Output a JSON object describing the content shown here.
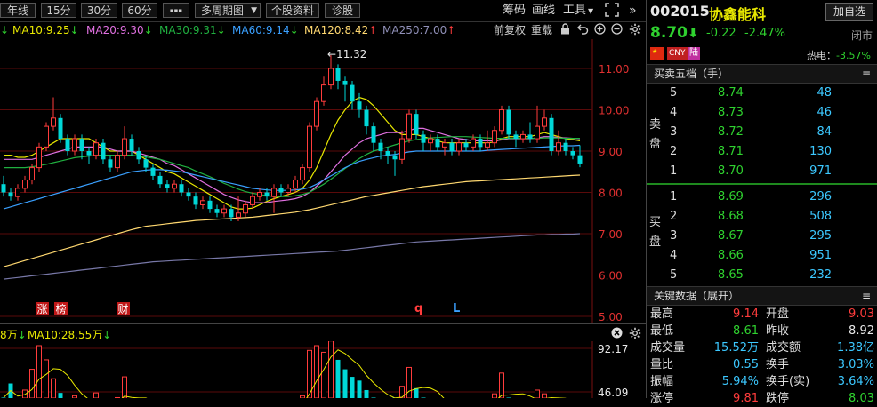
{
  "toolbar": {
    "periods": [
      "年线",
      "15分",
      "30分",
      "60分"
    ],
    "more": "▪▪▪",
    "multi_period": "多周期图",
    "stock_info": "个股资料",
    "diagnose": "诊股",
    "chip": "筹码",
    "draw": "画线",
    "tools": "工具"
  },
  "ma_bar": {
    "ma10": "MA10:9.25",
    "ma20": "MA20:9.30",
    "ma30": "MA30:9.31",
    "ma60": "MA60:9.14",
    "ma120": "MA120:8.42",
    "ma250": "MA250:7.00",
    "prev_adjust": "前复权",
    "redraw": "重载"
  },
  "colors": {
    "ma10": "#e8e800",
    "ma20": "#e070e0",
    "ma30": "#20b040",
    "ma60": "#3aa0ff",
    "ma120": "#ffd870",
    "ma250": "#7878a8",
    "up": "#ff3c3c",
    "down": "#00d8d8"
  },
  "chart_data": {
    "type": "candlestick",
    "y_ticks": [
      "11.00",
      "10.00",
      "9.00",
      "8.00",
      "7.00",
      "6.00",
      "5.00"
    ],
    "ylim": [
      5.0,
      11.5
    ],
    "high_marker": "←11.32",
    "tags": [
      "涨",
      "榜",
      "财"
    ],
    "letter_marks": [
      "q",
      "L"
    ],
    "candles": [
      [
        8.2,
        8.0,
        8.4,
        7.9
      ],
      [
        8.0,
        7.9,
        8.1,
        7.8
      ],
      [
        7.9,
        8.1,
        8.2,
        7.8
      ],
      [
        8.1,
        8.3,
        8.4,
        8.0
      ],
      [
        8.3,
        8.6,
        8.7,
        8.2
      ],
      [
        8.6,
        9.1,
        9.2,
        8.5
      ],
      [
        9.1,
        9.6,
        9.7,
        9.0
      ],
      [
        9.6,
        9.8,
        10.3,
        9.5
      ],
      [
        9.8,
        9.3,
        9.9,
        9.2
      ],
      [
        9.3,
        9.0,
        9.4,
        8.9
      ],
      [
        9.0,
        9.3,
        9.4,
        8.9
      ],
      [
        9.3,
        9.0,
        9.4,
        8.8
      ],
      [
        9.0,
        8.9,
        9.1,
        8.7
      ],
      [
        8.9,
        9.2,
        9.3,
        8.8
      ],
      [
        9.2,
        8.8,
        9.3,
        8.7
      ],
      [
        8.8,
        8.6,
        8.9,
        8.5
      ],
      [
        8.6,
        8.9,
        9.0,
        8.5
      ],
      [
        8.9,
        9.3,
        9.6,
        8.8
      ],
      [
        9.3,
        9.0,
        9.4,
        8.9
      ],
      [
        9.0,
        8.8,
        9.1,
        8.7
      ],
      [
        8.8,
        8.6,
        8.9,
        8.5
      ],
      [
        8.6,
        8.4,
        8.7,
        8.3
      ],
      [
        8.4,
        8.2,
        8.5,
        8.1
      ],
      [
        8.2,
        8.1,
        8.3,
        8.0
      ],
      [
        8.1,
        8.2,
        8.3,
        8.0
      ],
      [
        8.2,
        8.0,
        8.3,
        7.9
      ],
      [
        8.0,
        7.9,
        8.1,
        7.8
      ],
      [
        7.9,
        7.7,
        8.0,
        7.6
      ],
      [
        7.7,
        7.8,
        7.9,
        7.6
      ],
      [
        7.8,
        7.6,
        7.9,
        7.5
      ],
      [
        7.6,
        7.5,
        7.7,
        7.4
      ],
      [
        7.5,
        7.6,
        7.7,
        7.4
      ],
      [
        7.6,
        7.4,
        7.7,
        7.3
      ],
      [
        7.4,
        7.5,
        7.9,
        7.3
      ],
      [
        7.5,
        7.7,
        7.8,
        7.4
      ],
      [
        7.7,
        7.9,
        8.0,
        7.6
      ],
      [
        7.9,
        8.0,
        8.1,
        7.8
      ],
      [
        8.0,
        7.9,
        8.1,
        7.8
      ],
      [
        7.9,
        8.1,
        8.2,
        7.5
      ],
      [
        8.1,
        8.0,
        8.2,
        7.9
      ],
      [
        8.0,
        8.1,
        8.2,
        7.9
      ],
      [
        8.1,
        8.3,
        8.4,
        8.0
      ],
      [
        8.3,
        8.6,
        8.7,
        8.2
      ],
      [
        8.6,
        9.6,
        9.7,
        8.5
      ],
      [
        9.6,
        10.2,
        10.3,
        9.5
      ],
      [
        10.2,
        10.6,
        10.8,
        10.1
      ],
      [
        10.6,
        11.0,
        11.32,
        10.5
      ],
      [
        11.0,
        10.7,
        11.1,
        10.5
      ],
      [
        10.7,
        10.6,
        10.8,
        10.2
      ],
      [
        10.6,
        10.2,
        10.7,
        10.0
      ],
      [
        10.2,
        10.0,
        10.4,
        9.8
      ],
      [
        10.0,
        9.6,
        10.1,
        9.4
      ],
      [
        9.6,
        9.2,
        9.7,
        9.0
      ],
      [
        9.2,
        9.0,
        9.3,
        8.8
      ],
      [
        9.0,
        8.9,
        9.1,
        8.7
      ],
      [
        8.9,
        8.8,
        9.0,
        8.4
      ],
      [
        8.8,
        9.3,
        9.5,
        8.7
      ],
      [
        9.3,
        9.9,
        10.0,
        9.2
      ],
      [
        9.9,
        9.4,
        10.0,
        9.3
      ],
      [
        9.4,
        9.2,
        9.5,
        9.0
      ],
      [
        9.2,
        9.3,
        9.4,
        9.0
      ],
      [
        9.3,
        9.1,
        9.4,
        9.0
      ],
      [
        9.1,
        9.2,
        9.3,
        8.9
      ],
      [
        9.2,
        9.0,
        9.3,
        8.9
      ],
      [
        9.0,
        9.2,
        9.3,
        8.9
      ],
      [
        9.2,
        9.1,
        9.3,
        9.0
      ],
      [
        9.1,
        9.3,
        9.4,
        9.0
      ],
      [
        9.3,
        9.1,
        9.4,
        9.0
      ],
      [
        9.1,
        9.2,
        9.5,
        9.0
      ],
      [
        9.2,
        9.5,
        9.6,
        9.1
      ],
      [
        9.5,
        10.0,
        10.1,
        9.4
      ],
      [
        10.0,
        9.4,
        10.1,
        9.3
      ],
      [
        9.4,
        9.3,
        9.5,
        9.1
      ],
      [
        9.3,
        9.4,
        9.5,
        9.2
      ],
      [
        9.4,
        9.3,
        9.7,
        9.2
      ],
      [
        9.3,
        9.6,
        10.1,
        9.2
      ],
      [
        9.6,
        9.8,
        10.0,
        9.5
      ],
      [
        9.8,
        9.0,
        9.9,
        8.9
      ],
      [
        9.0,
        9.2,
        9.5,
        8.9
      ],
      [
        9.2,
        9.0,
        9.3,
        8.9
      ],
      [
        9.0,
        8.9,
        9.1,
        8.8
      ],
      [
        8.9,
        8.7,
        9.14,
        8.61
      ]
    ],
    "ma_lines": {
      "ma10": [
        8.9,
        8.9,
        8.85,
        8.85,
        8.9,
        9.0,
        9.1,
        9.2,
        9.3,
        9.3,
        9.3,
        9.3,
        9.3,
        9.2,
        9.1,
        9.0,
        9.0,
        9.0,
        9.0,
        8.9,
        8.8,
        8.7,
        8.6,
        8.5,
        8.45,
        8.35,
        8.25,
        8.15,
        8.05,
        7.95,
        7.85,
        7.75,
        7.65,
        7.6,
        7.6,
        7.62,
        7.7,
        7.78,
        7.85,
        7.9,
        7.95,
        8.0,
        8.1,
        8.3,
        8.6,
        9.0,
        9.4,
        9.75,
        10.0,
        10.2,
        10.3,
        10.25,
        10.1,
        9.9,
        9.7,
        9.5,
        9.4,
        9.4,
        9.4,
        9.35,
        9.3,
        9.25,
        9.2,
        9.2,
        9.2,
        9.2,
        9.2,
        9.2,
        9.2,
        9.22,
        9.3,
        9.35,
        9.35,
        9.35,
        9.35,
        9.4,
        9.45,
        9.4,
        9.35,
        9.3,
        9.28,
        9.25
      ],
      "ma20": [
        8.8,
        8.8,
        8.8,
        8.8,
        8.8,
        8.85,
        8.9,
        8.95,
        9.0,
        9.05,
        9.1,
        9.1,
        9.1,
        9.1,
        9.1,
        9.05,
        9.0,
        9.0,
        9.0,
        8.95,
        8.9,
        8.85,
        8.8,
        8.7,
        8.65,
        8.55,
        8.45,
        8.35,
        8.25,
        8.15,
        8.05,
        7.95,
        7.88,
        7.82,
        7.78,
        7.75,
        7.75,
        7.75,
        7.78,
        7.8,
        7.82,
        7.85,
        7.9,
        8.0,
        8.15,
        8.3,
        8.5,
        8.7,
        8.9,
        9.05,
        9.2,
        9.3,
        9.35,
        9.4,
        9.45,
        9.45,
        9.45,
        9.5,
        9.55,
        9.55,
        9.5,
        9.45,
        9.4,
        9.35,
        9.3,
        9.28,
        9.25,
        9.25,
        9.25,
        9.25,
        9.27,
        9.3,
        9.3,
        9.3,
        9.3,
        9.32,
        9.35,
        9.35,
        9.33,
        9.32,
        9.31,
        9.3
      ],
      "ma30": [
        8.6,
        8.6,
        8.6,
        8.6,
        8.62,
        8.65,
        8.68,
        8.72,
        8.76,
        8.8,
        8.84,
        8.86,
        8.88,
        8.9,
        8.9,
        8.9,
        8.9,
        8.9,
        8.9,
        8.88,
        8.86,
        8.83,
        8.8,
        8.75,
        8.7,
        8.65,
        8.6,
        8.52,
        8.45,
        8.38,
        8.3,
        8.22,
        8.15,
        8.08,
        8.02,
        7.98,
        7.95,
        7.92,
        7.9,
        7.9,
        7.9,
        7.92,
        7.95,
        8.0,
        8.1,
        8.2,
        8.32,
        8.45,
        8.58,
        8.7,
        8.82,
        8.92,
        9.0,
        9.05,
        9.1,
        9.15,
        9.2,
        9.25,
        9.28,
        9.3,
        9.32,
        9.33,
        9.34,
        9.35,
        9.35,
        9.35,
        9.34,
        9.33,
        9.32,
        9.31,
        9.31,
        9.31,
        9.31,
        9.31,
        9.31,
        9.31,
        9.32,
        9.32,
        9.32,
        9.31,
        9.31,
        9.31
      ],
      "ma60": [
        7.6,
        7.65,
        7.7,
        7.75,
        7.8,
        7.85,
        7.9,
        7.95,
        8.0,
        8.05,
        8.1,
        8.15,
        8.2,
        8.25,
        8.3,
        8.35,
        8.4,
        8.45,
        8.5,
        8.52,
        8.54,
        8.55,
        8.55,
        8.54,
        8.52,
        8.5,
        8.46,
        8.42,
        8.38,
        8.34,
        8.3,
        8.26,
        8.22,
        8.18,
        8.14,
        8.1,
        8.08,
        8.06,
        8.05,
        8.05,
        8.05,
        8.06,
        8.08,
        8.12,
        8.2,
        8.3,
        8.4,
        8.5,
        8.6,
        8.68,
        8.75,
        8.8,
        8.84,
        8.88,
        8.9,
        8.92,
        8.95,
        8.98,
        9.0,
        9.0,
        9.0,
        9.0,
        9.0,
        9.0,
        9.0,
        9.0,
        9.0,
        9.0,
        9.02,
        9.03,
        9.04,
        9.05,
        9.06,
        9.07,
        9.08,
        9.09,
        9.1,
        9.11,
        9.12,
        9.13,
        9.13,
        9.14
      ],
      "ma120": [
        6.2,
        6.25,
        6.3,
        6.35,
        6.4,
        6.45,
        6.5,
        6.55,
        6.6,
        6.65,
        6.7,
        6.75,
        6.8,
        6.85,
        6.9,
        6.95,
        7.0,
        7.05,
        7.1,
        7.14,
        7.18,
        7.2,
        7.22,
        7.24,
        7.26,
        7.28,
        7.3,
        7.32,
        7.33,
        7.34,
        7.35,
        7.36,
        7.37,
        7.38,
        7.39,
        7.4,
        7.42,
        7.44,
        7.46,
        7.48,
        7.5,
        7.52,
        7.55,
        7.58,
        7.62,
        7.66,
        7.7,
        7.74,
        7.78,
        7.82,
        7.86,
        7.9,
        7.93,
        7.96,
        7.99,
        8.02,
        8.05,
        8.08,
        8.11,
        8.14,
        8.16,
        8.18,
        8.2,
        8.22,
        8.24,
        8.26,
        8.27,
        8.28,
        8.29,
        8.3,
        8.31,
        8.32,
        8.33,
        8.34,
        8.35,
        8.36,
        8.37,
        8.38,
        8.39,
        8.4,
        8.41,
        8.42
      ],
      "ma250": [
        5.9,
        5.92,
        5.94,
        5.96,
        5.98,
        6.0,
        6.02,
        6.04,
        6.06,
        6.08,
        6.1,
        6.12,
        6.14,
        6.16,
        6.18,
        6.2,
        6.22,
        6.24,
        6.26,
        6.28,
        6.3,
        6.32,
        6.33,
        6.34,
        6.35,
        6.36,
        6.37,
        6.38,
        6.39,
        6.4,
        6.41,
        6.42,
        6.43,
        6.44,
        6.45,
        6.46,
        6.47,
        6.48,
        6.49,
        6.5,
        6.51,
        6.52,
        6.53,
        6.54,
        6.55,
        6.56,
        6.57,
        6.58,
        6.6,
        6.62,
        6.64,
        6.66,
        6.68,
        6.7,
        6.72,
        6.74,
        6.76,
        6.78,
        6.8,
        6.81,
        6.82,
        6.83,
        6.84,
        6.85,
        6.86,
        6.87,
        6.88,
        6.89,
        6.9,
        6.91,
        6.92,
        6.93,
        6.94,
        6.95,
        6.96,
        6.97,
        6.97,
        6.98,
        6.98,
        6.99,
        6.99,
        7.0
      ]
    },
    "volume": {
      "label_prefix": "8万",
      "ma10_label": "MA10:28.55万",
      "y_ticks": [
        "92.17",
        "46.09"
      ],
      "ylim": [
        0,
        92.17
      ]
    }
  },
  "stock": {
    "code": "002015",
    "name": "协鑫能科",
    "add_fav": "加自选",
    "price": "8.70",
    "change": "-0.22",
    "change_pct": "-2.47%",
    "status": "闭市",
    "tag_cn": "CNY",
    "tag_lu": "陆",
    "hot_label": "热电：",
    "hot_value": "-3.57%"
  },
  "order_book": {
    "title": "买卖五档（手）",
    "sell_label": "卖盘",
    "buy_label": "买盘",
    "sell": [
      {
        "level": "5",
        "price": "8.74",
        "vol": "48"
      },
      {
        "level": "4",
        "price": "8.73",
        "vol": "46"
      },
      {
        "level": "3",
        "price": "8.72",
        "vol": "84"
      },
      {
        "level": "2",
        "price": "8.71",
        "vol": "130"
      },
      {
        "level": "1",
        "price": "8.70",
        "vol": "971"
      }
    ],
    "buy": [
      {
        "level": "1",
        "price": "8.69",
        "vol": "296"
      },
      {
        "level": "2",
        "price": "8.68",
        "vol": "508"
      },
      {
        "level": "3",
        "price": "8.67",
        "vol": "295"
      },
      {
        "level": "4",
        "price": "8.66",
        "vol": "951"
      },
      {
        "level": "5",
        "price": "8.65",
        "vol": "232"
      }
    ]
  },
  "key_data": {
    "title": "关键数据（展开）",
    "rows": [
      {
        "l1": "最高",
        "v1": "9.14",
        "l2": "开盘",
        "v2": "9.03"
      },
      {
        "l1": "最低",
        "v1": "8.61",
        "l2": "昨收",
        "v2": "8.92"
      },
      {
        "l1": "成交量",
        "v1": "15.52万",
        "l2": "成交额",
        "v2": "1.38亿"
      },
      {
        "l1": "量比",
        "v1": "0.55",
        "l2": "换手",
        "v2": "3.03%"
      },
      {
        "l1": "振幅",
        "v1": "5.94%",
        "l2": "换手(实)",
        "v2": "3.64%"
      },
      {
        "l1": "涨停",
        "v1": "9.81",
        "l2": "跌停",
        "v2": "8.03"
      }
    ]
  }
}
